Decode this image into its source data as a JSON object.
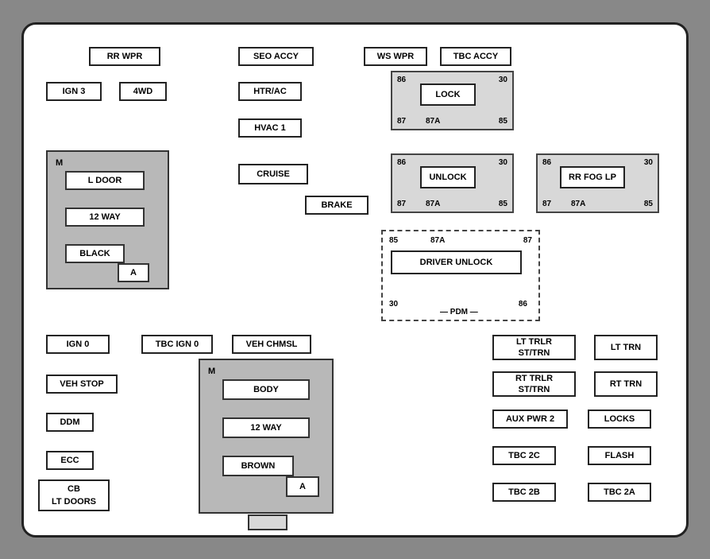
{
  "labels": {
    "rr_wpr": "RR WPR",
    "seo_accy": "SEO ACCY",
    "ws_wpr": "WS WPR",
    "tbc_accy": "TBC ACCY",
    "ign3": "IGN 3",
    "fwd": "4WD",
    "htr_ac": "HTR/AC",
    "hvac1": "HVAC 1",
    "cruise": "CRUISE",
    "brake": "BRAKE",
    "lock": "LOCK",
    "unlock": "UNLOCK",
    "rr_fog_lp": "RR FOG LP",
    "driver_unlock": "DRIVER UNLOCK",
    "pdm": "PDM",
    "ign0": "IGN 0",
    "tbc_ign0": "TBC IGN 0",
    "veh_chmsl": "VEH CHMSL",
    "veh_stop": "VEH STOP",
    "ddm": "DDM",
    "ecc": "ECC",
    "cb_lt_doors": "CB\nLT DOORS",
    "lt_trlr_st_trn": "LT TRLR\nST/TRN",
    "lt_trn": "LT TRN",
    "rt_trlr_st_trn": "RT TRLR\nST/TRN",
    "rt_trn": "RT TRN",
    "aux_pwr2": "AUX PWR 2",
    "locks": "LOCKS",
    "tbc_2c": "TBC 2C",
    "flash": "FLASH",
    "tbc_2b": "TBC 2B",
    "tbc_2a": "TBC 2A",
    "m_l": "M",
    "l_door": "L DOOR",
    "way12_l": "12 WAY",
    "black": "BLACK",
    "a_l": "A",
    "m_r": "M",
    "body": "BODY",
    "way12_r": "12 WAY",
    "brown": "BROWN",
    "a_r": "A"
  }
}
